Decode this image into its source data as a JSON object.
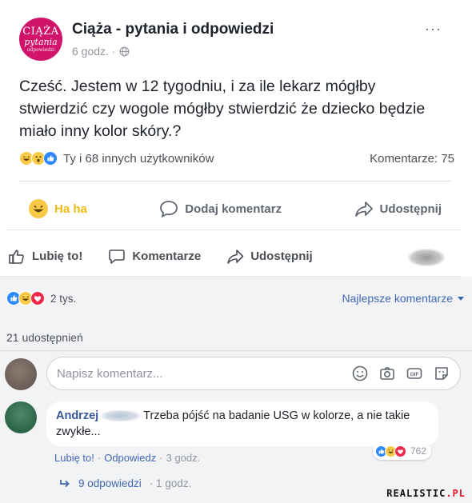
{
  "post": {
    "page_name": "Ciąża - pytania i odpowiedzi",
    "avatar_lines": [
      "CIĄŻA",
      "pytania",
      "odpowiedzi"
    ],
    "time": "6 godz. ·",
    "more": "···",
    "text": "Cześć. Jestem w 12 tygodniu, i za ile lekarz mógłby stwierdzić czy wogole mógłby stwierdzić że dziecko będzie miało inny kolor skóry.?",
    "reactions_text": "Ty i 68 innych użytkowników",
    "comments_count": "Komentarze: 75",
    "actions": {
      "haha": "Ha ha",
      "comment": "Dodaj komentarz",
      "share": "Udostępnij"
    }
  },
  "bottom": {
    "like_bar": {
      "like": "Lubię to!",
      "comment": "Komentarze",
      "share": "Udostępnij"
    },
    "reactions_count": "2 tys.",
    "best_comments": "Najlepsze komentarze",
    "shares": "21 udostępnień",
    "comment_placeholder": "Napisz komentarz...",
    "comment": {
      "author": "Andrzej",
      "text": "Trzeba pójść na badanie USG w kolorze, a nie takie zwykłe...",
      "reaction_count": "762",
      "like": "Lubię to!",
      "sep1": "·",
      "reply": "Odpowiedz",
      "sep2": "·",
      "time": "3 godz."
    },
    "replies": {
      "label": "9 odpowiedzi",
      "time": "· 1 godz."
    },
    "watermark": [
      "REALISTIC",
      ".PL"
    ]
  },
  "colors": {
    "accent": "#4267b2",
    "haha_yellow": "#f7c944",
    "like_blue": "#2d88ff",
    "love_red": "#f0284a",
    "page_pink": "#d1136a"
  }
}
